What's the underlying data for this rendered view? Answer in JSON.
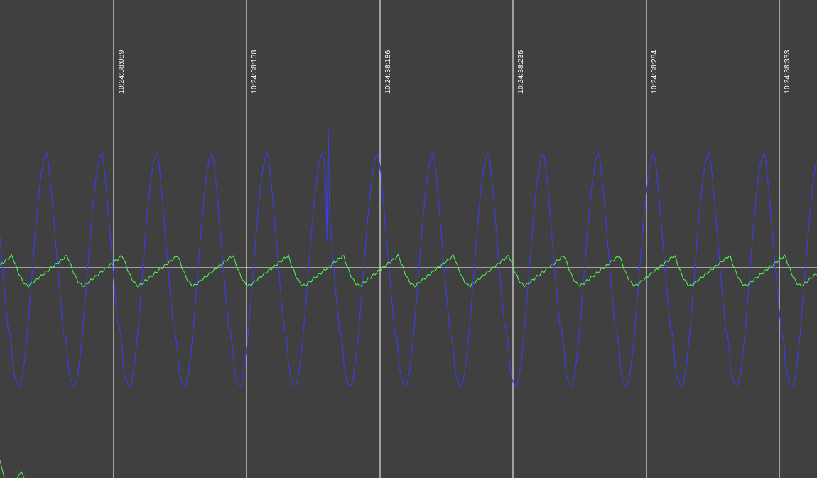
{
  "display": {
    "background_color": "#404040",
    "gridline_color": "#ffffff",
    "baseline_color": "#ffffff"
  },
  "time_markers": [
    "10:24:38:089",
    "10:24:38:138",
    "10:24:38:186",
    "10:24:38:235",
    "10:24:38:284",
    "10:24:38:333"
  ],
  "chart_data": {
    "type": "line",
    "xlabel": "",
    "ylabel": "",
    "grid": true,
    "legend": "none",
    "x_start": "10:24:38:048",
    "x_end": "10:24:38:347",
    "x_ticks": [
      "10:24:38:089",
      "10:24:38:138",
      "10:24:38:186",
      "10:24:38:235",
      "10:24:38:284",
      "10:24:38:333"
    ],
    "ylim": [
      -1.0,
      1.0
    ],
    "series": [
      {
        "color": "#3c3cf0",
        "shape": "periodic-peaked",
        "peak": 0.83,
        "trough": -0.86,
        "cycles": 14.8
      },
      {
        "color": "#50f050",
        "shape": "periodic-sawtooth",
        "peak": 0.09,
        "trough": -0.13,
        "cycles": 14.8
      }
    ]
  }
}
